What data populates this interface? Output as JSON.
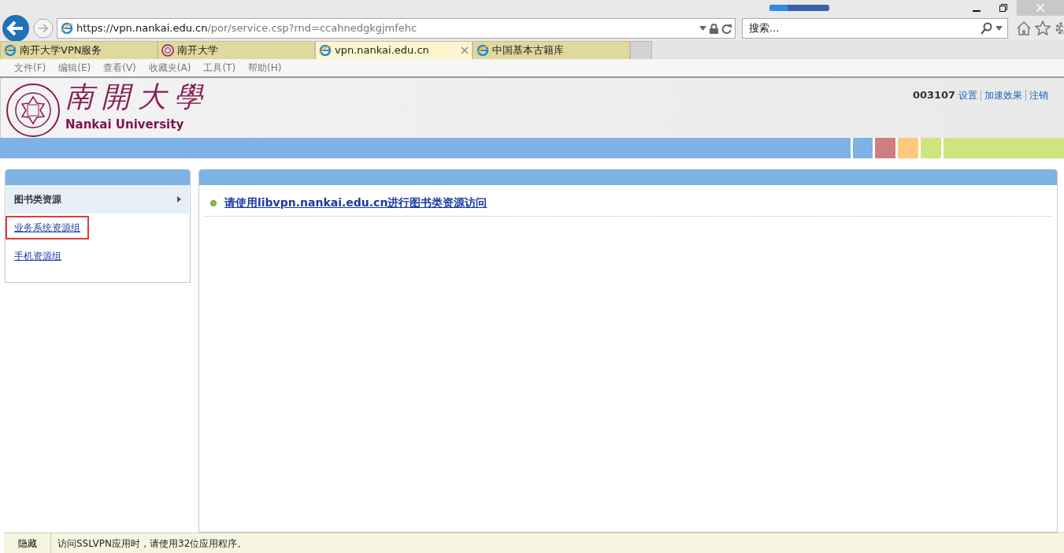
{
  "browser": {
    "address": {
      "scheme": "https://",
      "host": "vpn.nankai.edu.cn",
      "path": "/por/service.csp?rnd=ccahnedgkgjmfehc"
    },
    "search": {
      "placeholder": "搜索..."
    },
    "tabs": [
      {
        "label": "南开大学VPN服务",
        "selected": false
      },
      {
        "label": "南开大学",
        "selected": false
      },
      {
        "label": "vpn.nankai.edu.cn",
        "selected": true
      },
      {
        "label": "中国基本古籍库",
        "selected": false
      }
    ],
    "menu": [
      "文件(F)",
      "编辑(E)",
      "查看(V)",
      "收藏夹(A)",
      "工具(T)",
      "帮助(H)"
    ]
  },
  "header": {
    "logo_title": "南開大學",
    "logo_subtitle": "Nankai University",
    "user": "003107",
    "links": [
      "设置",
      "加速效果",
      "注销"
    ]
  },
  "sidebar": {
    "items": [
      {
        "label": "图书类资源",
        "kind": "category"
      },
      {
        "label": "业务系统资源组",
        "kind": "link",
        "highlighted": true
      },
      {
        "label": "手机资源组",
        "kind": "link",
        "highlighted": false
      }
    ]
  },
  "main": {
    "items": [
      "请使用libvpn.nankai.edu.cn进行图书类资源访问"
    ]
  },
  "status_bar": {
    "button": "隐藏",
    "message": "访问SSLVPN应用时，请使用32位应用程序。"
  }
}
